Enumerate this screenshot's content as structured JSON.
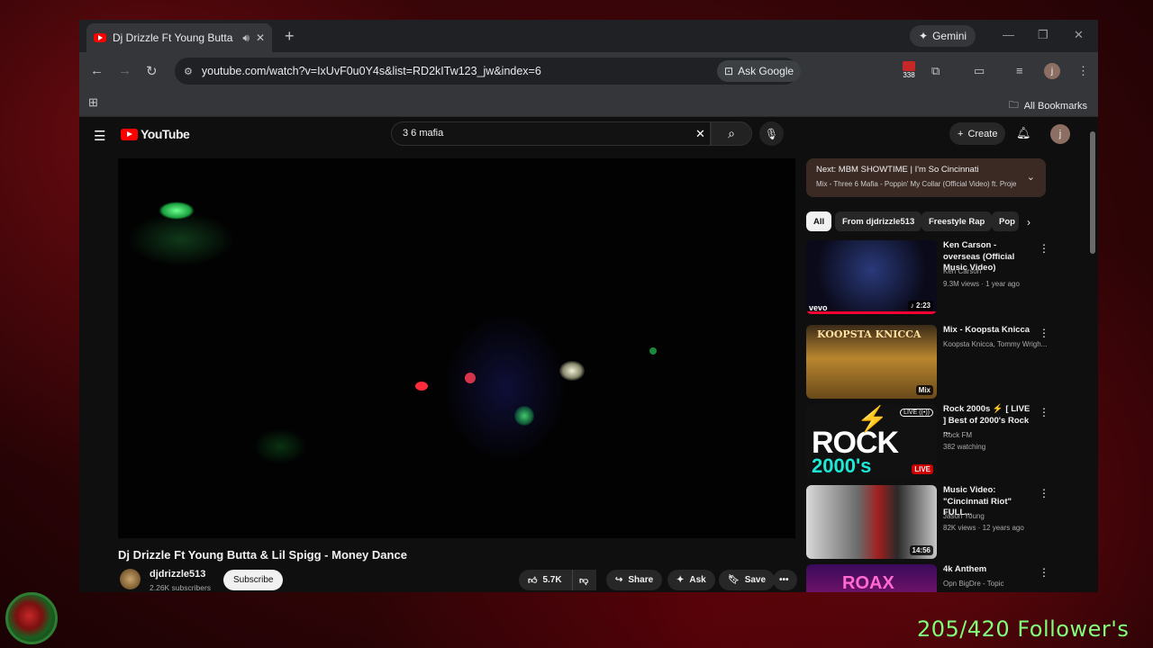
{
  "tab": {
    "title": "Dj Drizzle Ft Young Butta &"
  },
  "toolbar": {
    "url": "youtube.com/watch?v=IxUvF0u0Y4s&list=RD2kITw123_jw&index=6",
    "ask_google": "Ask Google",
    "gemini": "Gemini",
    "extension_badge": "338",
    "profile_initial": "j"
  },
  "bookmarks": {
    "all_bookmarks": "All Bookmarks"
  },
  "youtube": {
    "logo": "YouTube",
    "search_value": "3 6 mafia",
    "create": "Create",
    "avatar_initial": "j"
  },
  "video": {
    "title": "Dj Drizzle Ft Young Butta & Lil Spigg - Money Dance",
    "channel": "djdrizzle513",
    "subscribers": "2.26K subscribers",
    "subscribe": "Subscribe",
    "likes": "5.7K",
    "share": "Share",
    "ask": "Ask",
    "save": "Save"
  },
  "next": {
    "title": "Next: MBM SHOWTIME | I'm So Cincinnati",
    "subtitle": "Mix - Three 6 Mafia - Poppin' My Collar (Official Video) ft. Proje"
  },
  "chips": [
    "All",
    "From djdrizzle513",
    "Freestyle Rap",
    "Pop"
  ],
  "recommendations": [
    {
      "title": "Ken Carson - overseas (Official Music Video)",
      "channel": "Ken Carson",
      "meta": "9.3M views · 1 year ago",
      "duration": "♪ 2:23",
      "brand": "vevo"
    },
    {
      "title": "Mix - Koopsta Knicca",
      "channel": "Koopsta Knicca, Tommy Wrigh...",
      "meta": "",
      "duration": "Mix",
      "thumb_text": "KOOPSTA KNICCA"
    },
    {
      "title": "Rock 2000s ⚡ [ LIVE ] Best of 2000's Rock ...",
      "channel": "Rock FM",
      "meta": "382 watching",
      "duration": "LIVE",
      "thumb_text": "ROCK",
      "thumb_text2": "2000's",
      "live_badge": "LIVE ((•))"
    },
    {
      "title": "Music Video: \"Cincinnati Riot\" FULL...",
      "channel": "Jason Young",
      "meta": "82K views · 12 years ago",
      "duration": "14:56"
    },
    {
      "title": "4k Anthem",
      "channel": "Opn BigDre - Topic",
      "meta": "",
      "duration": "",
      "thumb_text": "ROAX"
    }
  ],
  "overlay": {
    "followers": "205/420 Follower's"
  }
}
